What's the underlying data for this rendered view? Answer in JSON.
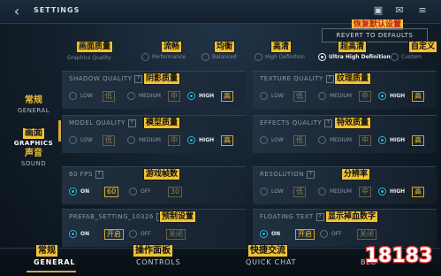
{
  "header": {
    "title": "SETTINGS"
  },
  "revert": {
    "label": "REVERT TO DEFAULTS",
    "callout": "恢复默认设置",
    "callout2": "自定义"
  },
  "presets": {
    "callout_label": "画面质量",
    "label": "Graphics Quality",
    "items": [
      {
        "cn": "流畅",
        "en": "Performance"
      },
      {
        "cn": "均衡",
        "en": "Balanced"
      },
      {
        "cn": "高清",
        "en": "High Definition"
      },
      {
        "cn": "超高清",
        "en": "Ultra High Definition"
      },
      {
        "cn": "自定义",
        "en": "Custom"
      }
    ],
    "selected": "Ultra High Definition"
  },
  "nav": [
    {
      "cn": "常规",
      "en": "GENERAL"
    },
    {
      "cn": "画面",
      "en": "GRAPHICS"
    },
    {
      "cn": "声音",
      "en": "SOUND"
    }
  ],
  "settings": {
    "shadow": {
      "title": "SHADOW QUALITY",
      "cn": "阴影质量",
      "low": "LOW",
      "low_cn": "低",
      "medium": "MEDIUM",
      "medium_cn": "中",
      "high": "HIGH",
      "high_cn": "高"
    },
    "texture": {
      "title": "TEXTURE QUALITY",
      "cn": "纹理质量",
      "low": "LOW",
      "low_cn": "低",
      "medium": "MEDIUM",
      "medium_cn": "中",
      "high": "HIGH",
      "high_cn": "高"
    },
    "model": {
      "title": "MODEL QUALITY",
      "cn": "模型质量",
      "low": "LOW",
      "low_cn": "低",
      "medium": "MEDIUM",
      "medium_cn": "中",
      "high": "HIGH",
      "high_cn": "高"
    },
    "effects": {
      "title": "EFFECTS QUALITY",
      "cn": "特效质量",
      "low": "LOW",
      "low_cn": "低",
      "medium": "MEDIUM",
      "medium_cn": "中",
      "high": "HIGH",
      "high_cn": "高"
    },
    "fps": {
      "title": "60 FPS",
      "cn": "游戏帧数",
      "on": "ON",
      "on_val": "60",
      "off": "OFF",
      "off_val": "30"
    },
    "resolution": {
      "title": "RESOLUTION",
      "cn": "分辨率",
      "low": "LOW",
      "low_cn": "低",
      "medium": "MEDIUM",
      "medium_cn": "中",
      "high": "HIGH",
      "high_cn": "高"
    },
    "prefab": {
      "title": "PREFAB_SETTING_10326",
      "cn": "预制设置",
      "on": "ON",
      "on_cn": "开启",
      "off": "OFF",
      "off_cn": "关闭"
    },
    "floating": {
      "title": "FLOATING TEXT",
      "cn": "显示掉血数字",
      "on": "ON",
      "on_cn": "开启",
      "off": "OFF",
      "off_cn": "关闭"
    }
  },
  "bottom_tabs": [
    {
      "cn": "常规",
      "en": "GENERAL"
    },
    {
      "cn": "操作面板",
      "en": "CONTROLS"
    },
    {
      "cn": "快捷交流",
      "en": "QUICK CHAT"
    },
    {
      "cn": "",
      "en": "BLO"
    }
  ],
  "watermark": {
    "text": "18183"
  },
  "colors": {
    "accent_gold": "#f0c233",
    "selected_radio": "#2fb9d6",
    "background": "#131f2b"
  }
}
